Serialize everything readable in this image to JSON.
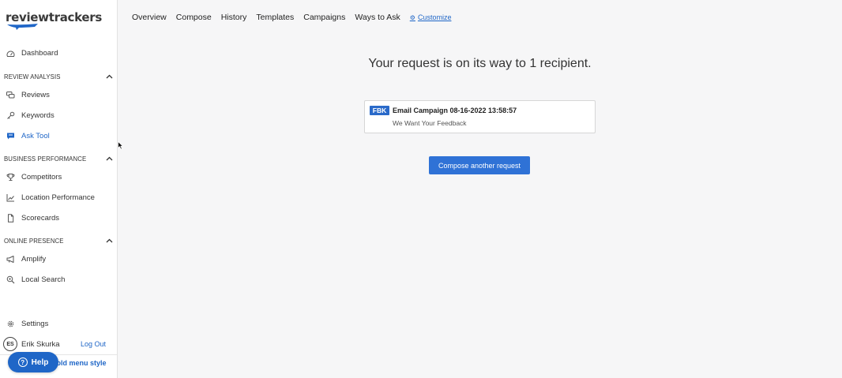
{
  "logo": {
    "text": "reviewtrackers"
  },
  "sidebar": {
    "dashboard": "Dashboard",
    "sections": [
      {
        "label": "REVIEW ANALYSIS",
        "items": [
          "Reviews",
          "Keywords",
          "Ask Tool"
        ]
      },
      {
        "label": "BUSINESS PERFORMANCE",
        "items": [
          "Competitors",
          "Location Performance",
          "Scorecards"
        ]
      },
      {
        "label": "ONLINE PRESENCE",
        "items": [
          "Amplify",
          "Local Search"
        ]
      }
    ],
    "settings": "Settings",
    "user": {
      "initials": "ES",
      "name": "Erik Skurka",
      "logout": "Log Out"
    },
    "old_menu": "e old menu style",
    "help": "Help"
  },
  "topnav": {
    "tabs": [
      "Overview",
      "Compose",
      "History",
      "Templates",
      "Campaigns",
      "Ways to Ask"
    ],
    "customize": "Customize"
  },
  "main": {
    "headline": "Your request is on its way to 1 recipient.",
    "card": {
      "badge": "FBK",
      "title": "Email Campaign 08-16-2022 13:58:57",
      "subtitle": "We Want Your Feedback"
    },
    "compose_button": "Compose another request"
  },
  "colors": {
    "accent": "#1f66c7",
    "button": "#2f72d6",
    "badge": "#2a6ac9"
  }
}
